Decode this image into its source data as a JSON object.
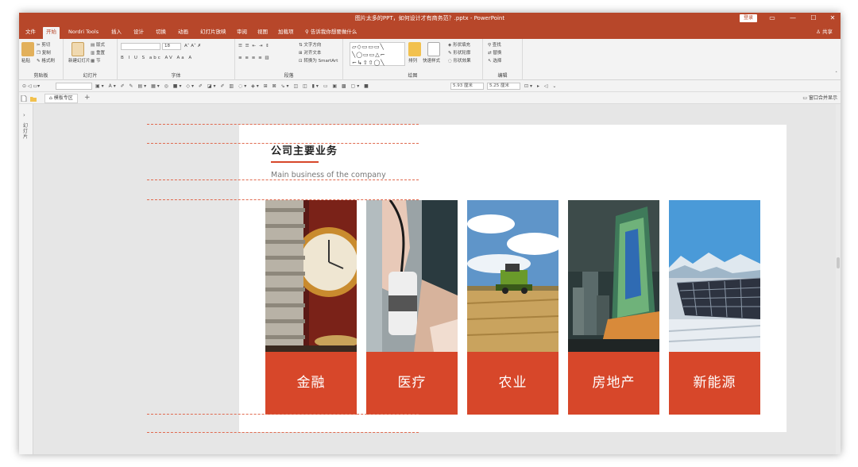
{
  "window": {
    "title": "图片太多的PPT，如何设计才有商务范？.pptx - PowerPoint",
    "login_label": "登录",
    "controls": [
      "▭",
      "—",
      "☐",
      "✕"
    ]
  },
  "ribbon_tabs": [
    "文件",
    "开始",
    "Nordri Tools",
    "插入",
    "设计",
    "切换",
    "动画",
    "幻灯片放映",
    "审阅",
    "视图",
    "加载项"
  ],
  "active_tab": "开始",
  "tell_me": "告诉我你想要做什么",
  "share_label": "共享",
  "ribbon": {
    "clipboard": {
      "label": "剪贴板",
      "paste": "粘贴",
      "cut": "剪切",
      "copy": "复制",
      "format_painter": "格式刷"
    },
    "slides": {
      "label": "幻灯片",
      "new_slide": "新建幻灯片",
      "layout": "版式",
      "reset": "重置",
      "section": "节"
    },
    "font": {
      "label": "字体",
      "size": "18",
      "buttons": "B I U S abc AV Aa A"
    },
    "paragraph": {
      "label": "段落",
      "text_direction": "文字方向",
      "align_text": "对齐文本",
      "smartart": "转换为 SmartArt"
    },
    "drawing": {
      "label": "绘图",
      "arrange": "排列",
      "quick_styles": "快速样式",
      "fill": "形状填充",
      "outline": "形状轮廓",
      "effects": "形状效果",
      "shapes": "▱◇▭▭▭╲ ╲◯▭▭△⌐ ⌐↳⇧⇧◯╲"
    },
    "editing": {
      "label": "编辑",
      "find": "查找",
      "replace": "替换",
      "select": "选择"
    }
  },
  "format_bar": {
    "width": "5.93 厘米",
    "height": "5.25 厘米"
  },
  "file_tab": {
    "name": "模板专区",
    "add": "+",
    "merge": "窗口合并显示"
  },
  "left_pane": {
    "chev": "›",
    "text": "幻灯片"
  },
  "slide": {
    "title": "公司主要业务",
    "subtitle": "Main business of the company",
    "cards": [
      {
        "label": "金融",
        "photo": "finance-photo"
      },
      {
        "label": "医疗",
        "photo": "medical-photo"
      },
      {
        "label": "农业",
        "photo": "agriculture-photo"
      },
      {
        "label": "房地产",
        "photo": "real-estate-photo"
      },
      {
        "label": "新能源",
        "photo": "new-energy-photo"
      }
    ]
  },
  "colors": {
    "brand": "#b7472a",
    "accent": "#d7472a",
    "guide": "#e06a4f",
    "workspace": "#e6e6e6"
  }
}
